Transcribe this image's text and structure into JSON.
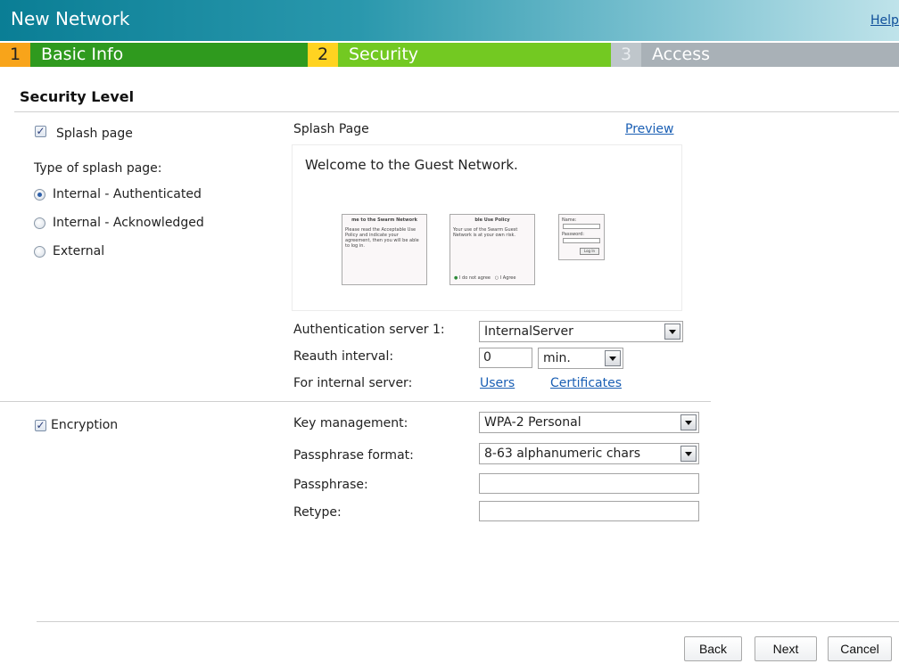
{
  "window": {
    "title": "New Network",
    "help": "Help"
  },
  "steps": [
    {
      "num": "1",
      "label": "Basic Info"
    },
    {
      "num": "2",
      "label": "Security"
    },
    {
      "num": "3",
      "label": "Access"
    }
  ],
  "section": {
    "title": "Security Level"
  },
  "splash": {
    "checkbox_label": "Splash page",
    "checked": true,
    "type_label": "Type of splash page:",
    "options": [
      "Internal - Authenticated",
      "Internal - Acknowledged",
      "External"
    ],
    "selected": "Internal - Authenticated",
    "panel_title": "Splash Page",
    "preview_link": "Preview",
    "preview": {
      "welcome": "Welcome to the Guest Network.",
      "card1_title": "me to the Swarm Network",
      "card1_body": "Please read the Acceptable Use Policy and indicate your agreement, then you will be able to log in.",
      "card2_title": "ble Use Policy",
      "card2_body": "Your use of the Swarm Guest Network is at your own risk.",
      "card2_disagree": "I do not agree",
      "card2_agree": "I Agree",
      "card3_name": "Name:",
      "card3_password": "Password:",
      "card3_button": "Log In"
    }
  },
  "auth": {
    "server_label": "Authentication server 1:",
    "server_value": "InternalServer",
    "reauth_label": "Reauth interval:",
    "reauth_value": "0",
    "reauth_unit": "min.",
    "internal_label": "For internal server:",
    "users_link": "Users",
    "certs_link": "Certificates"
  },
  "encryption": {
    "checkbox_label": "Encryption",
    "checked": true,
    "key_label": "Key management:",
    "key_value": "WPA-2 Personal",
    "format_label": "Passphrase format:",
    "format_value": "8-63 alphanumeric chars",
    "passphrase_label": "Passphrase:",
    "passphrase_value": "",
    "retype_label": "Retype:",
    "retype_value": ""
  },
  "buttons": {
    "back": "Back",
    "next": "Next",
    "cancel": "Cancel"
  },
  "colors": {
    "step1": "#2f9a1e",
    "step1_num": "#f8a41a",
    "step2": "#73c922",
    "step2_num": "#ffd321",
    "step3": "#a9b1b7",
    "title_bar": "#0a7e95",
    "link": "#1a5fb4"
  }
}
